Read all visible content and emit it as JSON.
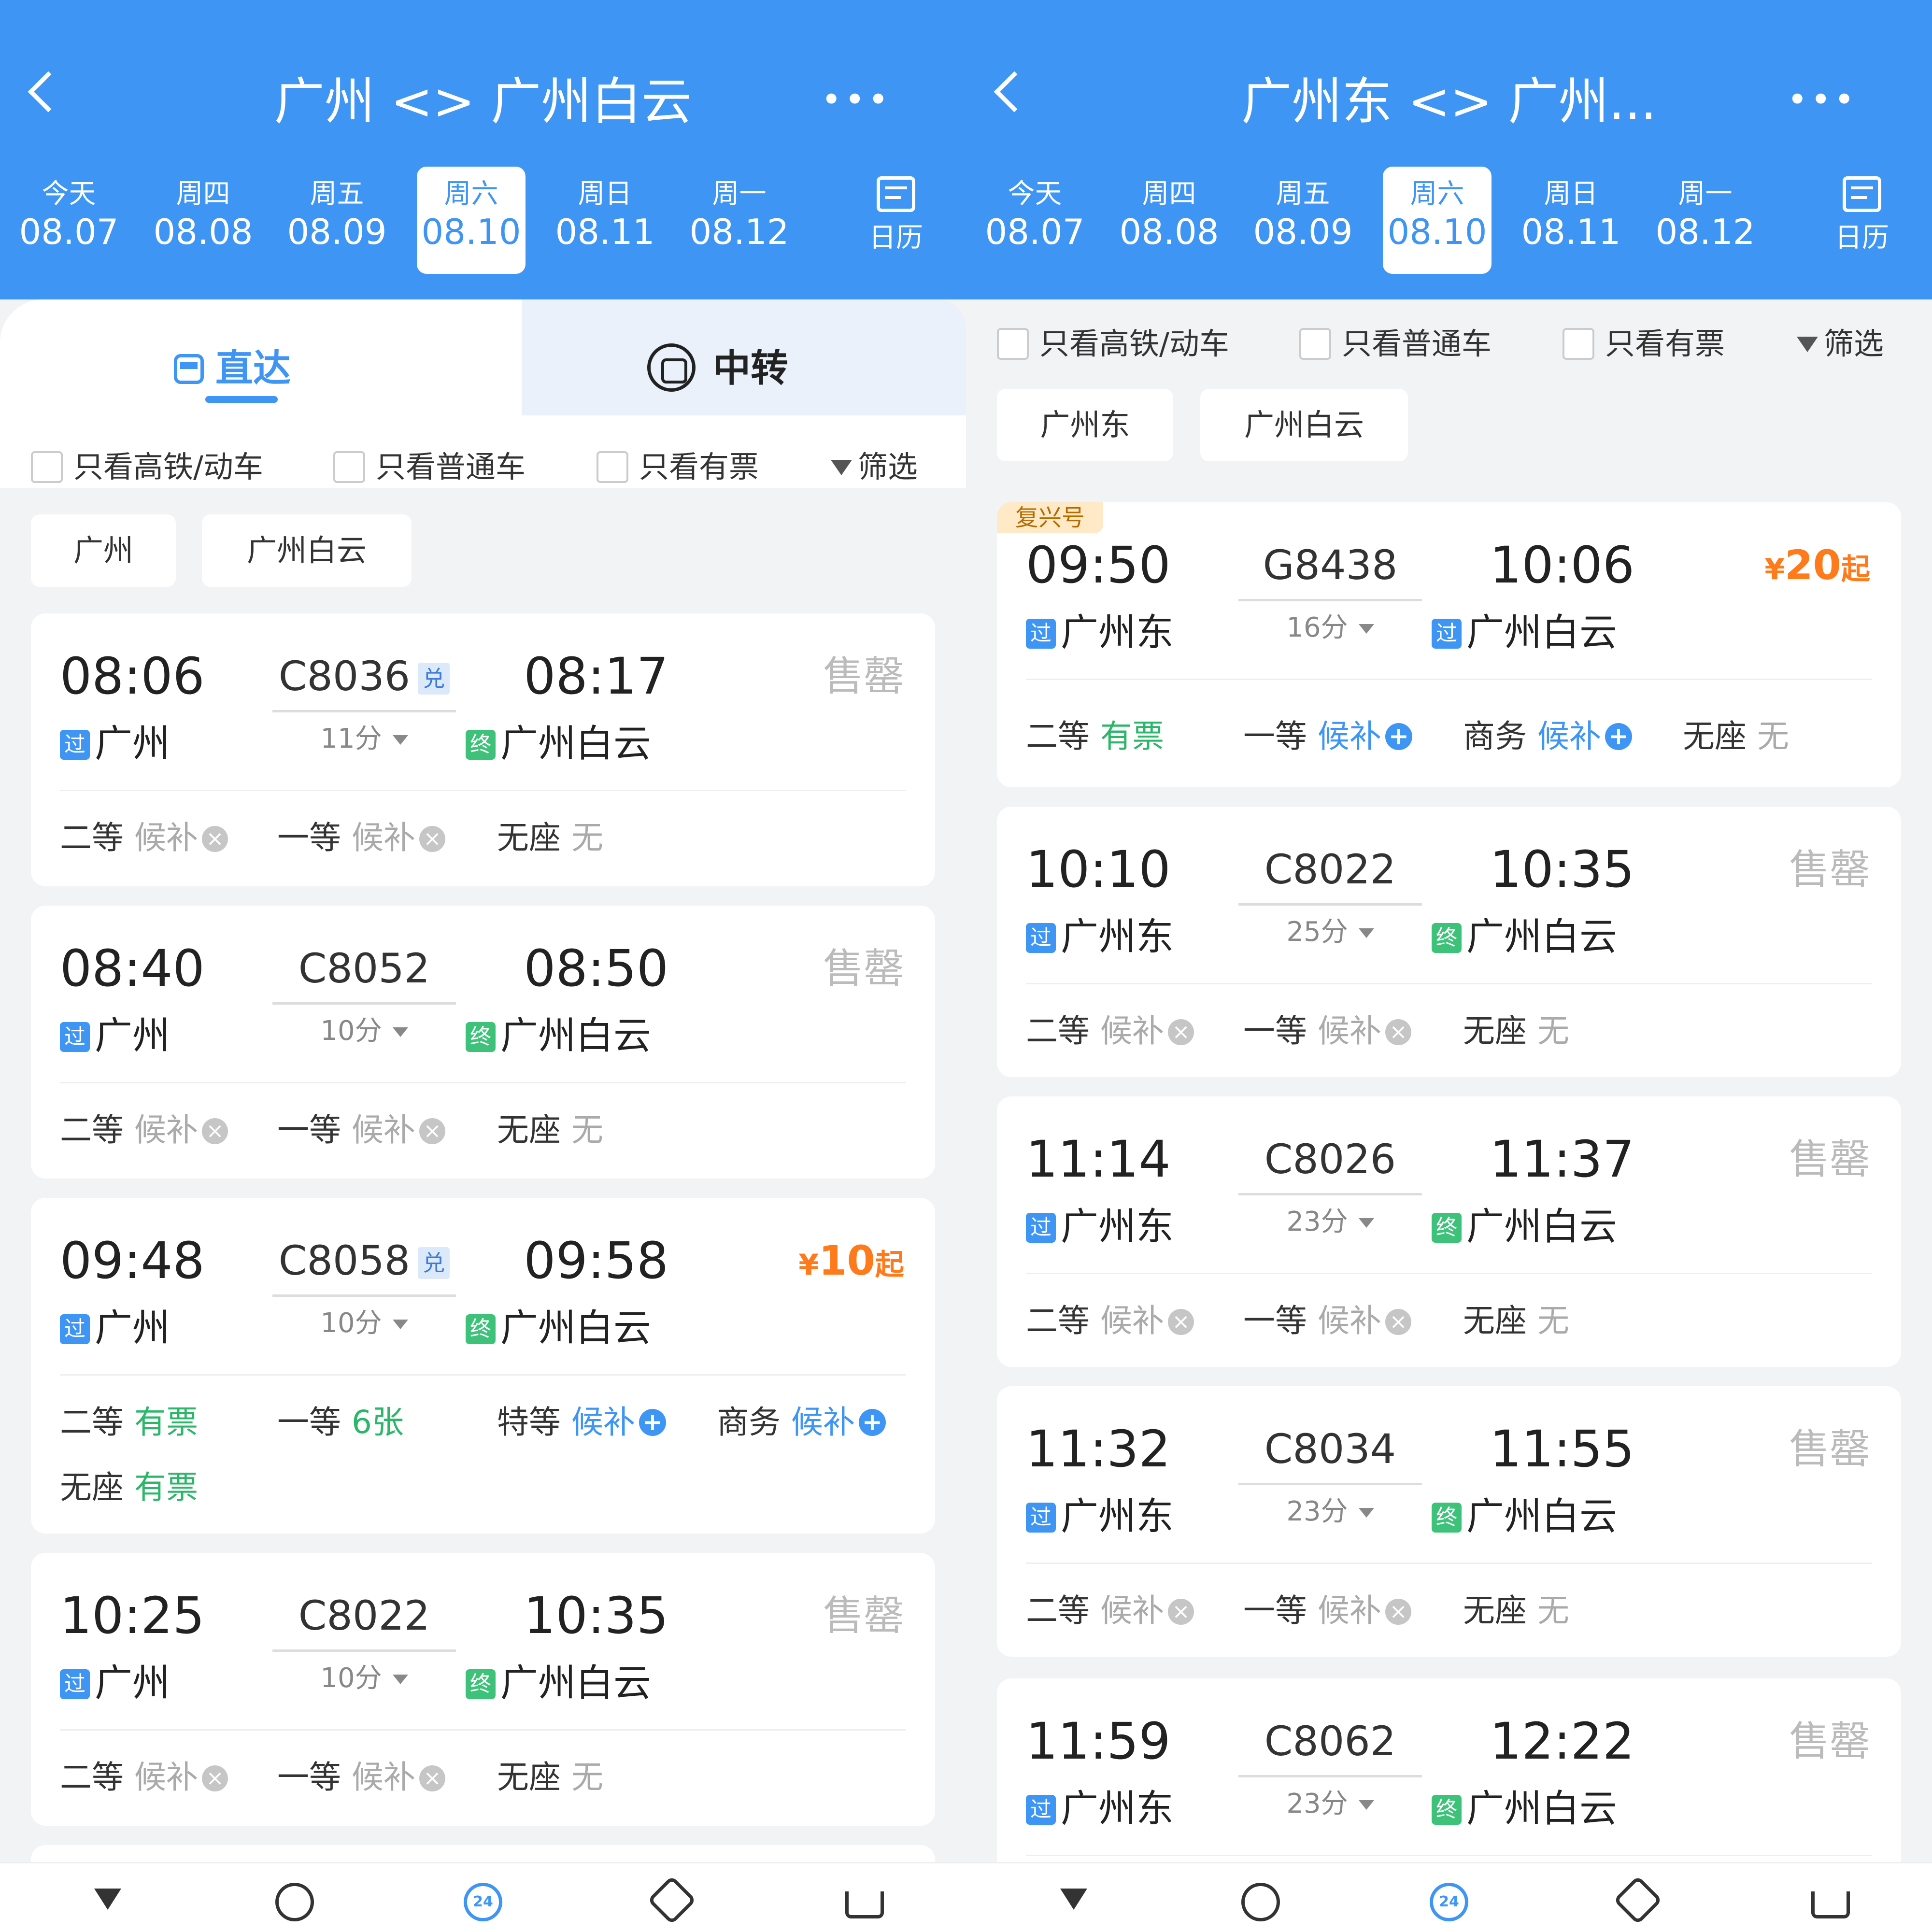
{
  "left": {
    "header": {
      "title": "广州 <> 广州白云",
      "more": "•••"
    },
    "dates": [
      {
        "weekday": "今天",
        "date": "08.07",
        "selected": false
      },
      {
        "weekday": "周四",
        "date": "08.08",
        "selected": false
      },
      {
        "weekday": "周五",
        "date": "08.09",
        "selected": false
      },
      {
        "weekday": "周六",
        "date": "08.10",
        "selected": true
      },
      {
        "weekday": "周日",
        "date": "08.11",
        "selected": false
      },
      {
        "weekday": "周一",
        "date": "08.12",
        "selected": false
      }
    ],
    "calendar_label": "日历",
    "tabs": {
      "direct": "直达",
      "transfer": "中转"
    },
    "filters": {
      "high_speed": "只看高铁/动车",
      "normal": "只看普通车",
      "available": "只看有票",
      "filter": "筛选"
    },
    "stations": [
      "广州",
      "广州白云"
    ],
    "trains": [
      {
        "dep": "08:06",
        "arr": "08:17",
        "no": "C8036",
        "dui": "兑",
        "dur": "11分",
        "from": "广州",
        "to": "广州白云",
        "from_badge": "过",
        "to_badge": "终",
        "price": "售罄",
        "sold": true,
        "seats": [
          {
            "cls": "二等",
            "st": "候补",
            "type": "x"
          },
          {
            "cls": "一等",
            "st": "候补",
            "type": "x"
          },
          {
            "cls": "无座",
            "st": "无",
            "type": "none"
          }
        ]
      },
      {
        "dep": "08:40",
        "arr": "08:50",
        "no": "C8052",
        "dui": "",
        "dur": "10分",
        "from": "广州",
        "to": "广州白云",
        "from_badge": "过",
        "to_badge": "终",
        "price": "售罄",
        "sold": true,
        "seats": [
          {
            "cls": "二等",
            "st": "候补",
            "type": "x"
          },
          {
            "cls": "一等",
            "st": "候补",
            "type": "x"
          },
          {
            "cls": "无座",
            "st": "无",
            "type": "none"
          }
        ]
      },
      {
        "dep": "09:48",
        "arr": "09:58",
        "no": "C8058",
        "dui": "兑",
        "dur": "10分",
        "from": "广州",
        "to": "广州白云",
        "from_badge": "过",
        "to_badge": "终",
        "price_symbol": "¥",
        "price_num": "10",
        "price_suffix": "起",
        "sold": false,
        "seats": [
          {
            "cls": "二等",
            "st": "有票",
            "type": "green"
          },
          {
            "cls": "一等",
            "st": "6张",
            "type": "green"
          },
          {
            "cls": "特等",
            "st": "候补",
            "type": "plus"
          },
          {
            "cls": "商务",
            "st": "候补",
            "type": "plus"
          },
          {
            "cls": "无座",
            "st": "有票",
            "type": "green"
          }
        ]
      },
      {
        "dep": "10:25",
        "arr": "10:35",
        "no": "C8022",
        "dui": "",
        "dur": "10分",
        "from": "广州",
        "to": "广州白云",
        "from_badge": "过",
        "to_badge": "终",
        "price": "售罄",
        "sold": true,
        "seats": [
          {
            "cls": "二等",
            "st": "候补",
            "type": "x"
          },
          {
            "cls": "一等",
            "st": "候补",
            "type": "x"
          },
          {
            "cls": "无座",
            "st": "无",
            "type": "none"
          }
        ]
      }
    ]
  },
  "right": {
    "header": {
      "title": "广州东 <> 广州...",
      "more": "•••"
    },
    "dates": [
      {
        "weekday": "今天",
        "date": "08.07",
        "selected": false
      },
      {
        "weekday": "周四",
        "date": "08.08",
        "selected": false
      },
      {
        "weekday": "周五",
        "date": "08.09",
        "selected": false
      },
      {
        "weekday": "周六",
        "date": "08.10",
        "selected": true
      },
      {
        "weekday": "周日",
        "date": "08.11",
        "selected": false
      },
      {
        "weekday": "周一",
        "date": "08.12",
        "selected": false
      }
    ],
    "calendar_label": "日历",
    "filters": {
      "high_speed": "只看高铁/动车",
      "normal": "只看普通车",
      "available": "只看有票",
      "filter": "筛选"
    },
    "stations": [
      "广州东",
      "广州白云"
    ],
    "trains": [
      {
        "tag": "复兴号",
        "dep": "09:50",
        "arr": "10:06",
        "no": "G8438",
        "dui": "",
        "dur": "16分",
        "from": "广州东",
        "to": "广州白云",
        "from_badge": "过",
        "to_badge": "过",
        "price_symbol": "¥",
        "price_num": "20",
        "price_suffix": "起",
        "sold": false,
        "seats": [
          {
            "cls": "二等",
            "st": "有票",
            "type": "green"
          },
          {
            "cls": "一等",
            "st": "候补",
            "type": "plus"
          },
          {
            "cls": "商务",
            "st": "候补",
            "type": "plus"
          },
          {
            "cls": "无座",
            "st": "无",
            "type": "none"
          }
        ]
      },
      {
        "dep": "10:10",
        "arr": "10:35",
        "no": "C8022",
        "dui": "",
        "dur": "25分",
        "from": "广州东",
        "to": "广州白云",
        "from_badge": "过",
        "to_badge": "终",
        "price": "售罄",
        "sold": true,
        "seats": [
          {
            "cls": "二等",
            "st": "候补",
            "type": "x"
          },
          {
            "cls": "一等",
            "st": "候补",
            "type": "x"
          },
          {
            "cls": "无座",
            "st": "无",
            "type": "none"
          }
        ]
      },
      {
        "dep": "11:14",
        "arr": "11:37",
        "no": "C8026",
        "dui": "",
        "dur": "23分",
        "from": "广州东",
        "to": "广州白云",
        "from_badge": "过",
        "to_badge": "终",
        "price": "售罄",
        "sold": true,
        "seats": [
          {
            "cls": "二等",
            "st": "候补",
            "type": "x"
          },
          {
            "cls": "一等",
            "st": "候补",
            "type": "x"
          },
          {
            "cls": "无座",
            "st": "无",
            "type": "none"
          }
        ]
      },
      {
        "dep": "11:32",
        "arr": "11:55",
        "no": "C8034",
        "dui": "",
        "dur": "23分",
        "from": "广州东",
        "to": "广州白云",
        "from_badge": "过",
        "to_badge": "终",
        "price": "售罄",
        "sold": true,
        "seats": [
          {
            "cls": "二等",
            "st": "候补",
            "type": "x"
          },
          {
            "cls": "一等",
            "st": "候补",
            "type": "x"
          },
          {
            "cls": "无座",
            "st": "无",
            "type": "none"
          }
        ]
      },
      {
        "dep": "11:59",
        "arr": "12:22",
        "no": "C8062",
        "dui": "",
        "dur": "23分",
        "from": "广州东",
        "to": "广州白云",
        "from_badge": "过",
        "to_badge": "终",
        "price": "售罄",
        "sold": true,
        "seats": []
      }
    ]
  },
  "bottom_nav_icons": [
    "filter-icon",
    "clock-icon",
    "24h-icon",
    "tag-icon",
    "cart-icon"
  ],
  "bottom_nav_24": "24",
  "colors": {
    "primary": "#3e95f3",
    "green": "#2cb66a",
    "orange": "#ff7a1a",
    "gray": "#aaaaaa"
  }
}
